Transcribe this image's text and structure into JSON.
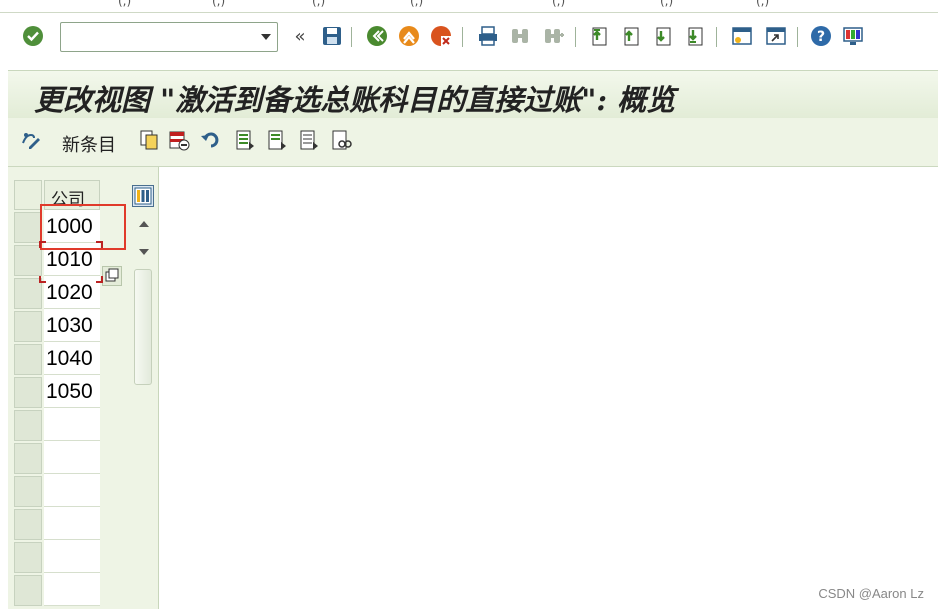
{
  "menu_fragments": [
    "(,)",
    "(,)",
    "(,)",
    "(,)",
    "(,)",
    "(,)",
    "(,)"
  ],
  "command_field": {
    "value": "",
    "placeholder": ""
  },
  "toolbar_icons": [
    "enter-checkmark-icon",
    "back-double-chevron-icon",
    "save-icon",
    "back-icon",
    "exit-icon",
    "cancel-icon",
    "print-icon",
    "find-icon",
    "find-next-icon",
    "first-page-icon",
    "previous-page-icon",
    "next-page-icon",
    "last-page-icon",
    "create-session-icon",
    "generate-shortcut-icon",
    "help-icon",
    "customize-layout-icon"
  ],
  "title": "更改视图 \"激活到备选总账科目的直接过账\": 概览",
  "app_toolbar": {
    "new_entries_label": "新条目",
    "icons": [
      "display-change-icon",
      "copy-as-icon",
      "delete-icon",
      "undo-icon",
      "select-all-icon",
      "select-block-icon",
      "deselect-all-icon",
      "print-view-icon"
    ]
  },
  "table": {
    "column_header": "公司",
    "rows": [
      "1000",
      "1010",
      "1020",
      "1030",
      "1040",
      "1050",
      "",
      "",
      "",
      "",
      "",
      ""
    ]
  },
  "colors": {
    "title_bg": "#e6efdc",
    "highlight": "#e03a2b",
    "accent_green": "#5aa02c"
  },
  "watermark": "CSDN @Aaron Lz"
}
